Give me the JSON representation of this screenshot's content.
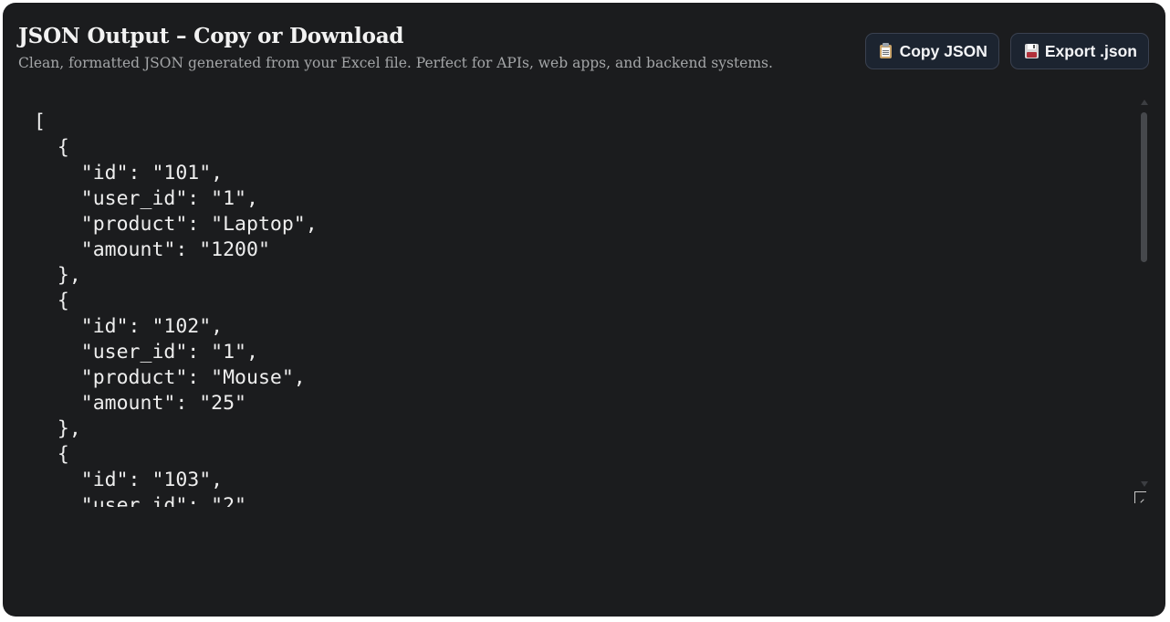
{
  "header": {
    "title": "JSON Output – Copy or Download",
    "subtitle": "Clean, formatted JSON generated from your Excel file. Perfect for APIs, web apps, and backend systems."
  },
  "actions": {
    "copy_label": "Copy JSON",
    "copy_icon": "clipboard-icon",
    "export_label": "Export .json",
    "export_icon": "floppy-disk-icon"
  },
  "output": {
    "json_text": "[\n  {\n    \"id\": \"101\",\n    \"user_id\": \"1\",\n    \"product\": \"Laptop\",\n    \"amount\": \"1200\"\n  },\n  {\n    \"id\": \"102\",\n    \"user_id\": \"1\",\n    \"product\": \"Mouse\",\n    \"amount\": \"25\"\n  },\n  {\n    \"id\": \"103\",\n    \"user_id\": \"2\","
  },
  "colors": {
    "panel_background": "#1b1c1e",
    "button_background": "#1c2430",
    "text": "#eeeeee",
    "subtitle": "#a4a6a8"
  }
}
